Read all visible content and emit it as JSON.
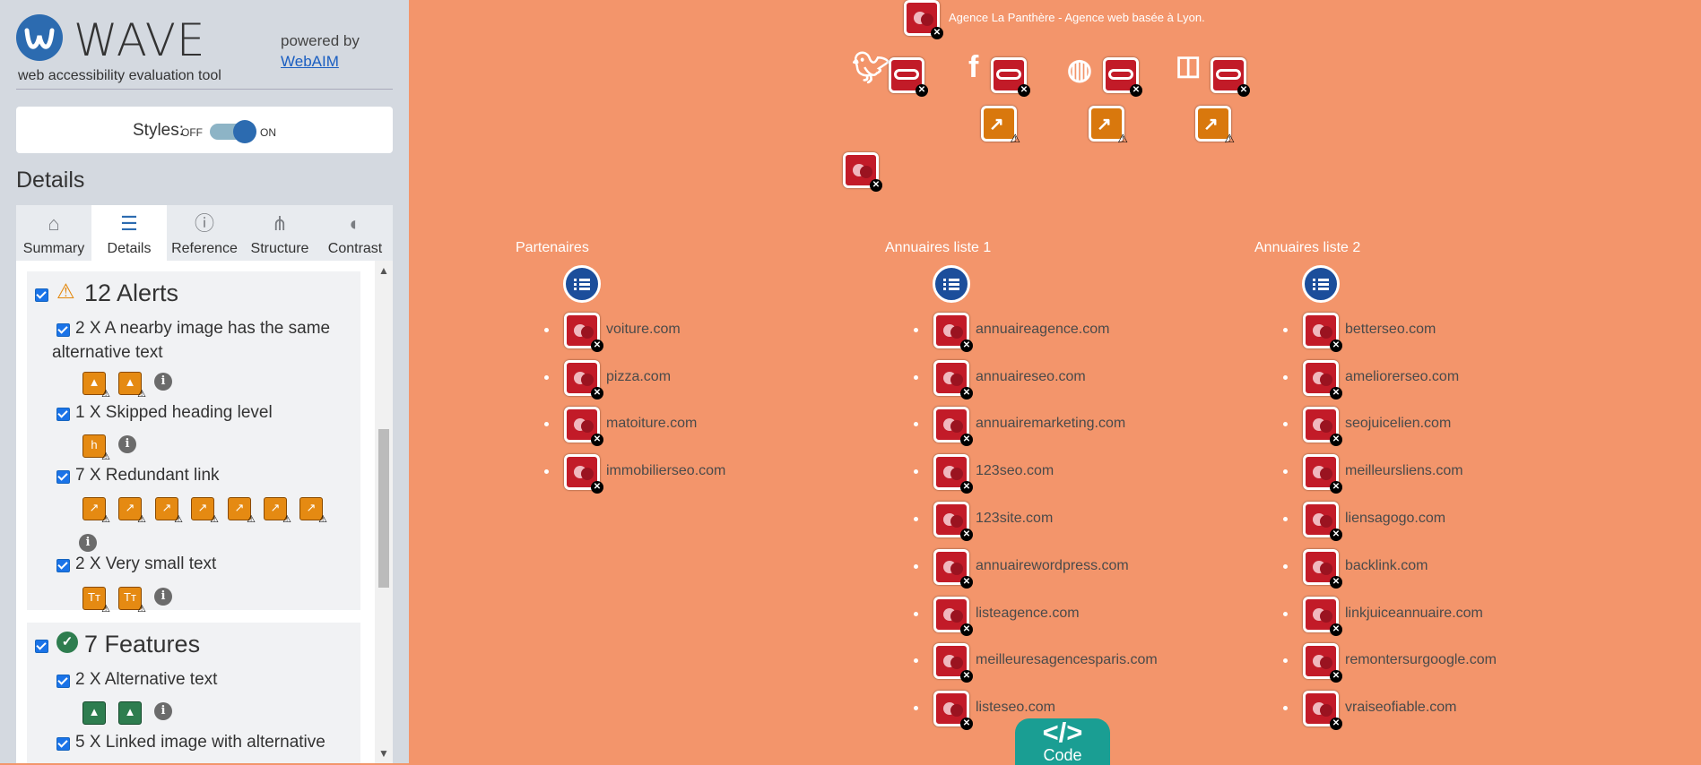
{
  "sidebar": {
    "logo_word": "WAVE",
    "logo_sub": "web accessibility evaluation tool",
    "powered_by": "powered by",
    "webaim_link": "WebAIM",
    "styles_label": "Styles:",
    "styles_off": "OFF",
    "styles_on": "ON",
    "details_title": "Details",
    "tabs": [
      {
        "label": "Summary"
      },
      {
        "label": "Details"
      },
      {
        "label": "Reference"
      },
      {
        "label": "Structure"
      },
      {
        "label": "Contrast"
      }
    ],
    "alerts": {
      "title": "12 Alerts",
      "items": [
        {
          "text": "2 X A nearby image has the same alternative text"
        },
        {
          "text": "1 X Skipped heading level"
        },
        {
          "text": "7 X Redundant link"
        },
        {
          "text": "2 X Very small text"
        }
      ]
    },
    "features": {
      "title": "7 Features",
      "items": [
        {
          "text": "2 X Alternative text"
        },
        {
          "text": "5 X Linked image with alternative"
        }
      ]
    }
  },
  "page": {
    "top_text": "Agence La Panthère - Agence web basée à Lyon.",
    "columns": [
      {
        "title": "Partenaires",
        "links": [
          "voiture.com",
          "pizza.com",
          "matoiture.com",
          "immobilierseo.com"
        ]
      },
      {
        "title": "Annuaires liste 1",
        "links": [
          "annuaireagence.com",
          "annuaireseo.com",
          "annuairemarketing.com",
          "123seo.com",
          "123site.com",
          "annuairewordpress.com",
          "listeagence.com",
          "meilleuresagencesparis.com",
          "listeseo.com"
        ]
      },
      {
        "title": "Annuaires liste 2",
        "links": [
          "betterseo.com",
          "ameliorerseo.com",
          "seojuicelien.com",
          "meilleursliens.com",
          "liensagogo.com",
          "backlink.com",
          "linkjuiceannuaire.com",
          "remontersurgoogle.com",
          "vraiseofiable.com"
        ]
      }
    ],
    "code_button": "Code",
    "code_symbol": "</>"
  },
  "colors": {
    "page_bg": "#f3956b",
    "wave_blue": "#2c6bb0",
    "error_red": "#c21b28",
    "alert_orange": "#d9780d",
    "feature_green": "#2e7d4f",
    "code_teal": "#1a9e93"
  }
}
